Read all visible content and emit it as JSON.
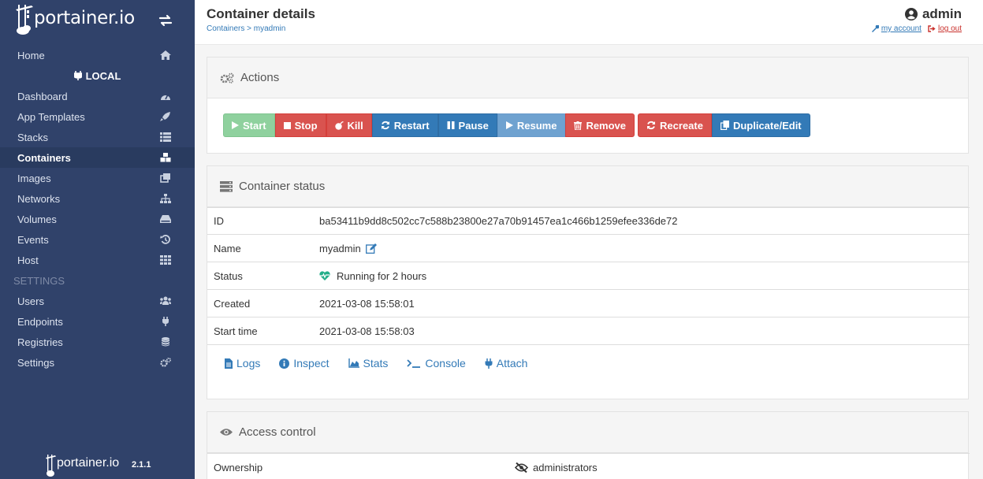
{
  "brand": {
    "name": "portainer.io",
    "version": "2.1.1"
  },
  "sidebar": {
    "home": "Home",
    "endpoint": "LOCAL",
    "items": [
      {
        "label": "Dashboard"
      },
      {
        "label": "App Templates"
      },
      {
        "label": "Stacks"
      },
      {
        "label": "Containers"
      },
      {
        "label": "Images"
      },
      {
        "label": "Networks"
      },
      {
        "label": "Volumes"
      },
      {
        "label": "Events"
      },
      {
        "label": "Host"
      }
    ],
    "settings_title": "SETTINGS",
    "settings_items": [
      {
        "label": "Users"
      },
      {
        "label": "Endpoints"
      },
      {
        "label": "Registries"
      },
      {
        "label": "Settings"
      }
    ],
    "active": "Containers"
  },
  "header": {
    "title": "Container details",
    "breadcrumb_root": "Containers",
    "breadcrumb_sep": " > ",
    "breadcrumb_current": "myadmin",
    "user": "admin",
    "my_account": "my account",
    "log_out": "log out"
  },
  "actions": {
    "title": "Actions",
    "buttons": {
      "start": "Start",
      "stop": "Stop",
      "kill": "Kill",
      "restart": "Restart",
      "pause": "Pause",
      "resume": "Resume",
      "remove": "Remove",
      "recreate": "Recreate",
      "duplicate": "Duplicate/Edit"
    }
  },
  "status": {
    "title": "Container status",
    "rows": [
      {
        "key": "ID",
        "value": "ba53411b9dd8c502cc7c588b23800e27a70b91457ea1c466b1259efee336de72"
      },
      {
        "key": "Name",
        "value": "myadmin"
      },
      {
        "key": "Status",
        "value": "Running for 2 hours"
      },
      {
        "key": "Created",
        "value": "2021-03-08 15:58:01"
      },
      {
        "key": "Start time",
        "value": "2021-03-08 15:58:03"
      }
    ],
    "links": {
      "logs": "Logs",
      "inspect": "Inspect",
      "stats": "Stats",
      "console": "Console",
      "attach": "Attach"
    }
  },
  "access": {
    "title": "Access control",
    "ownership_key": "Ownership",
    "ownership_value": "administrators"
  },
  "colors": {
    "sidebar_bg": "#30426a",
    "sidebar_active": "#293b5f",
    "primary": "#337ab7",
    "danger": "#d9534f",
    "success_disabled": "#8fd19e",
    "status_running": "#23ae89"
  }
}
